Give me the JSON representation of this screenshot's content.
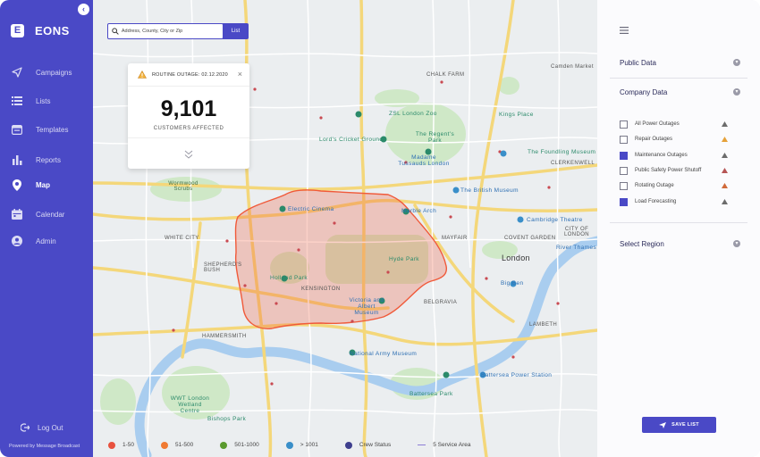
{
  "sidebar": {
    "brand": "EONS",
    "brand_logo": "E",
    "items": [
      {
        "label": "Campaigns",
        "icon": "send-icon"
      },
      {
        "label": "Lists",
        "icon": "list-icon"
      },
      {
        "label": "Templates",
        "icon": "template-icon"
      },
      {
        "label": "Reports",
        "icon": "bar-chart-icon"
      },
      {
        "label": "Map",
        "icon": "map-pin-icon",
        "active": true
      },
      {
        "label": "Calendar",
        "icon": "calendar-icon"
      },
      {
        "label": "Admin",
        "icon": "user-icon"
      }
    ],
    "logout": "Log Out",
    "powered_by": "Powered by Message Broadcast"
  },
  "search": {
    "placeholder": "Address, County, City or Zip",
    "list_button": "List"
  },
  "outage_card": {
    "title": "ROUTINE OUTAGE: 02.12.2020",
    "count": "9,101",
    "subtitle": "CUSTOMERS AFFECTED",
    "close": "×"
  },
  "map_labels": {
    "chalk_farm": "CHALK FARM",
    "london_zoo": "ZSL London Zoo",
    "regents_park": "The Regent's Park",
    "kings_place": "Kings Place",
    "lords": "Lord's Cricket Ground",
    "madame": "Madame Tussauds London",
    "foundling": "The Foundling Museum",
    "clerkenwell": "CLERKENWELL",
    "british_museum": "The British Museum",
    "wormwood": "Wormwood Scrubs",
    "electric_cinema": "Electric Cinema",
    "marble_arch": "Marble Arch",
    "cambridge": "Cambridge Theatre",
    "white_city": "WHITE CITY",
    "mayfair": "MAYFAIR",
    "covent_garden": "COVENT GARDEN",
    "london": "London",
    "shepherds_bush": "SHEPHERD'S BUSH",
    "hyde_park": "Hyde Park",
    "holland_park": "Holland Park",
    "kensington": "KENSINGTON",
    "va_museum": "Victoria and Albert Museum",
    "belgravia": "BELGRAVIA",
    "big_ben": "Big Ben",
    "lambeth": "LAMBETH",
    "hammersmith": "HAMMERSMITH",
    "national_army": "National Army Museum",
    "battersea_ps": "Battersea Power Station",
    "battersea_park": "Battersea Park",
    "wwt": "WWT London Wetland Centre",
    "bishops_park": "Bishops Park",
    "camden": "Camden Market",
    "city_of_london": "CITY OF LONDON",
    "river_thames": "River Thames"
  },
  "legend": [
    {
      "label": "1-50",
      "color": "#e8523f"
    },
    {
      "label": "51-500",
      "color": "#f07a32"
    },
    {
      "label": "501-1000",
      "color": "#5a9a2e"
    },
    {
      "label": "> 1001",
      "color": "#3a8fc9"
    },
    {
      "label": "Crew Status",
      "color": "#3e3f8e"
    },
    {
      "label": "5 Service Area",
      "color": "#8c7dd6"
    }
  ],
  "panel": {
    "public_data": "Public Data",
    "company_data": "Company Data",
    "select_region": "Select Region",
    "options": [
      {
        "label": "All Power Outages",
        "checked": false,
        "icon_color": "#6c6c6c"
      },
      {
        "label": "Repair Outages",
        "checked": false,
        "icon_color": "#e5a13a"
      },
      {
        "label": "Maintenance Outages",
        "checked": true,
        "icon_color": "#6c6c6c"
      },
      {
        "label": "Public Safety Power Shutoff",
        "checked": false,
        "icon_color": "#b65555"
      },
      {
        "label": "Rotating Outage",
        "checked": false,
        "icon_color": "#d06a3a"
      },
      {
        "label": "Load Forecasting",
        "checked": true,
        "icon_color": "#6c6c6c"
      }
    ],
    "save_list": "SAVE LIST"
  },
  "colors": {
    "brand": "#4a49c6",
    "outage_area": "#f05a3a"
  }
}
